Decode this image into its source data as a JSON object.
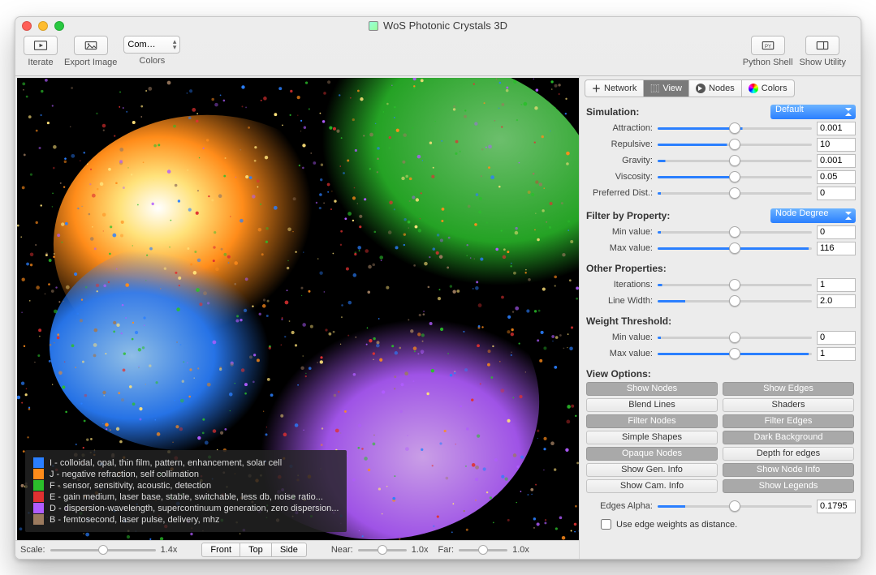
{
  "window": {
    "title": "WoS Photonic Crystals 3D"
  },
  "toolbar": {
    "iterate": "Iterate",
    "export_image": "Export Image",
    "colors_combo": "Com…",
    "colors_label": "Colors",
    "python_shell": "Python Shell",
    "show_utility": "Show Utility"
  },
  "legend": [
    {
      "color": "#2a7fff",
      "text": "I - colloidal, opal, thin film, pattern, enhancement, solar cell"
    },
    {
      "color": "#ff8c1a",
      "text": "J - negative refraction, self collimation"
    },
    {
      "color": "#2bbf2b",
      "text": "F - sensor, sensitivity, acoustic, detection"
    },
    {
      "color": "#e03131",
      "text": "E - gain medium, laser base, stable, switchable, less db, noise ratio..."
    },
    {
      "color": "#b05cff",
      "text": "D - dispersion-wavelength, supercontinuum generation, zero dispersion..."
    },
    {
      "color": "#9b7a5e",
      "text": "B - femtosecond, laser pulse, delivery, mhz"
    }
  ],
  "viz_controls": {
    "scale_label": "Scale:",
    "scale_val": "1.4x",
    "front": "Front",
    "top": "Top",
    "side": "Side",
    "near_label": "Near:",
    "near_val": "1.0x",
    "far_label": "Far:",
    "far_val": "1.0x"
  },
  "tabs": {
    "network": "Network",
    "view": "View",
    "nodes": "Nodes",
    "colors": "Colors"
  },
  "panel": {
    "simulation": {
      "heading": "Simulation:",
      "preset": "Default",
      "attraction": {
        "label": "Attraction:",
        "value": "0.001",
        "pct": 55
      },
      "repulsive": {
        "label": "Repulsive:",
        "value": "10",
        "pct": 45
      },
      "gravity": {
        "label": "Gravity:",
        "value": "0.001",
        "pct": 5
      },
      "viscosity": {
        "label": "Viscosity:",
        "value": "0.05",
        "pct": 50
      },
      "pref_dist": {
        "label": "Preferred Dist.:",
        "value": "0",
        "pct": 2
      }
    },
    "filter": {
      "heading": "Filter by Property:",
      "property": "Node Degree",
      "min": {
        "label": "Min value:",
        "value": "0",
        "pct": 2
      },
      "max": {
        "label": "Max value:",
        "value": "116",
        "pct": 98
      }
    },
    "other": {
      "heading": "Other Properties:",
      "iterations": {
        "label": "Iterations:",
        "value": "1",
        "pct": 3
      },
      "linewidth": {
        "label": "Line Width:",
        "value": "2.0",
        "pct": 18
      }
    },
    "weight": {
      "heading": "Weight Threshold:",
      "min": {
        "label": "Min value:",
        "value": "0",
        "pct": 2
      },
      "max": {
        "label": "Max value:",
        "value": "1",
        "pct": 98
      }
    },
    "view_options": {
      "heading": "View Options:",
      "buttons": [
        {
          "label": "Show Nodes",
          "on": true
        },
        {
          "label": "Show Edges",
          "on": true
        },
        {
          "label": "Blend Lines",
          "on": false
        },
        {
          "label": "Shaders",
          "on": false
        },
        {
          "label": "Filter Nodes",
          "on": true
        },
        {
          "label": "Filter Edges",
          "on": true
        },
        {
          "label": "Simple Shapes",
          "on": false
        },
        {
          "label": "Dark Background",
          "on": true
        },
        {
          "label": "Opaque Nodes",
          "on": true
        },
        {
          "label": "Depth for edges",
          "on": false
        },
        {
          "label": "Show Gen. Info",
          "on": false
        },
        {
          "label": "Show Node Info",
          "on": true
        },
        {
          "label": "Show Cam. Info",
          "on": false
        },
        {
          "label": "Show Legends",
          "on": true
        }
      ],
      "edges_alpha": {
        "label": "Edges Alpha:",
        "value": "0.1795",
        "pct": 18
      },
      "checkbox": "Use edge weights as distance."
    }
  }
}
